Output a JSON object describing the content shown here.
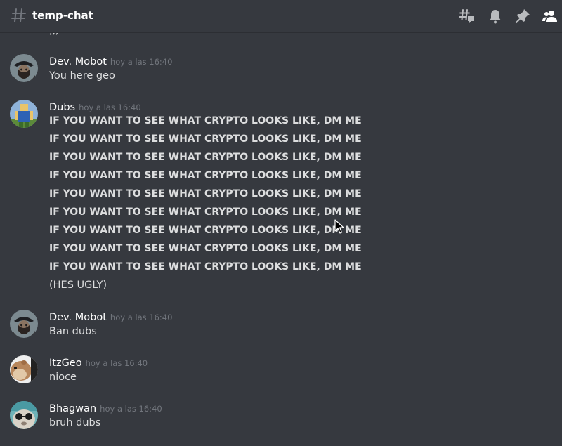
{
  "header": {
    "channel_name": "temp-chat",
    "icons": [
      "threads-icon",
      "bell-icon",
      "pin-icon",
      "members-icon"
    ]
  },
  "partial_previous_text": ",,,",
  "messages": [
    {
      "username": "Dev. Mobot",
      "timestamp": "hoy a las 16:40",
      "lines": [
        "You here geo"
      ],
      "avatar": "pirate-avatar"
    },
    {
      "username": "Dubs",
      "timestamp": "hoy a las 16:40",
      "lines": [
        "IF YOU WANT TO SEE WHAT CRYPTO LOOKS LIKE, DM ME",
        "IF YOU WANT TO SEE WHAT CRYPTO LOOKS LIKE, DM ME",
        "IF YOU WANT TO SEE WHAT CRYPTO LOOKS LIKE, DM ME",
        "IF YOU WANT TO SEE WHAT CRYPTO LOOKS LIKE, DM ME",
        "IF YOU WANT TO SEE WHAT CRYPTO LOOKS LIKE, DM ME",
        "IF YOU WANT TO SEE WHAT CRYPTO LOOKS LIKE, DM ME",
        "IF YOU WANT TO SEE WHAT CRYPTO LOOKS LIKE, DM ME",
        "IF YOU WANT TO SEE WHAT CRYPTO LOOKS LIKE, DM ME",
        "IF YOU WANT TO SEE WHAT CRYPTO LOOKS LIKE, DM ME"
      ],
      "last_line": "(HES UGLY)",
      "avatar": "blocky-avatar"
    },
    {
      "username": "Dev. Mobot",
      "timestamp": "hoy a las 16:40",
      "lines": [
        "Ban dubs"
      ],
      "avatar": "pirate-avatar"
    },
    {
      "username": "ItzGeo",
      "timestamp": "hoy a las 16:40",
      "lines": [
        "nioce"
      ],
      "avatar": "hamster-avatar"
    },
    {
      "username": "Bhagwan",
      "timestamp": "hoy a las 16:40",
      "lines": [
        "bruh dubs"
      ],
      "avatar": "sunglasses-avatar"
    }
  ],
  "colors": {
    "background": "#36393f",
    "text": "#dcddde",
    "username": "#ffffff",
    "timestamp": "#72767d",
    "icon": "#b9bbbe"
  }
}
